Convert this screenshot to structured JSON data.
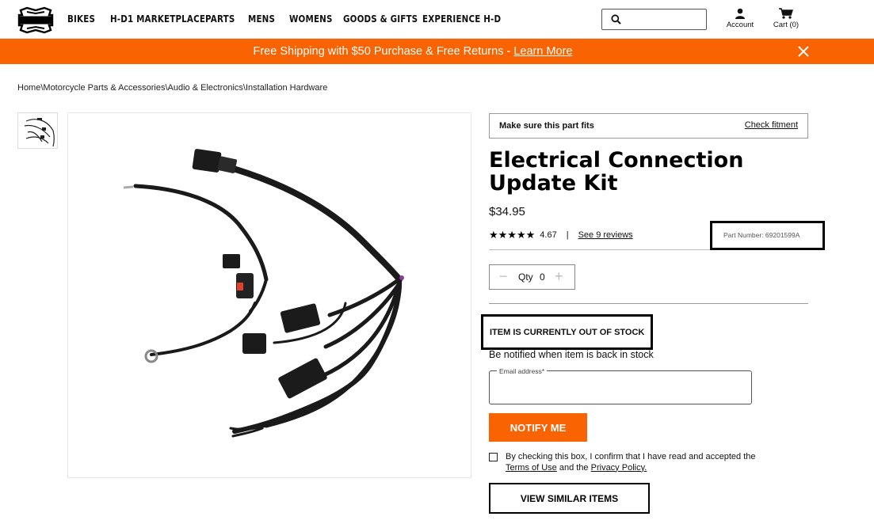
{
  "header": {
    "nav": [
      "BIKES",
      "H-D1 MARKETPLACE",
      "PARTS",
      "MENS",
      "WOMENS",
      "GOODS & GIFTS",
      "EXPERIENCE H-D"
    ],
    "search_placeholder": "",
    "account_label": "Account",
    "cart_label": "Cart (0)",
    "logo_icon": "harley-davidson-shield-logo"
  },
  "promo": {
    "text": "Free Shipping with $50 Purchase & Free Returns - ",
    "link": "Learn More",
    "background": "#f96302"
  },
  "breadcrumb": [
    "Home",
    "Motorcycle Parts & Accessories",
    "Audio & Electronics",
    "Installation Hardware"
  ],
  "fitment": {
    "label": "Make sure this part fits",
    "link": "Check fitment"
  },
  "product": {
    "title": "Electrical Connection Update Kit",
    "price": "$34.95",
    "stars": "★★★★★",
    "rating": "4.67",
    "separator": "|",
    "reviews_link": "See 9 reviews",
    "part_number": "Part Number: 69201599A"
  },
  "quantity": {
    "minus": "−",
    "plus": "+",
    "label": "Qty",
    "value": "0"
  },
  "stock": {
    "status": "ITEM IS CURRENTLY OUT OF STOCK",
    "notify_prompt": "Be notified when item is back in stock",
    "email_label": "Email address*",
    "email_value": "",
    "notify_button": "NOTIFY ME"
  },
  "consent": {
    "prefix": "By checking this box, I confirm that I have read and accepted the ",
    "terms": "Terms of Use",
    "middle": " and the ",
    "privacy": "Privacy Policy."
  },
  "similar_button": "VIEW SIMILAR ITEMS",
  "colors": {
    "accent": "#f96302",
    "text": "#111111"
  }
}
